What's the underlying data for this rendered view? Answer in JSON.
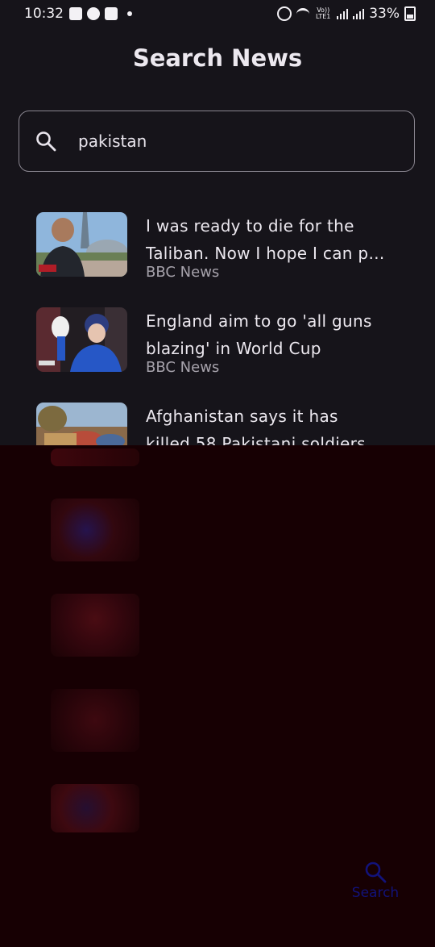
{
  "status_bar": {
    "time": "10:32",
    "network_tag": "Vo)) LTE1",
    "battery": "33%"
  },
  "header": {
    "title": "Search News"
  },
  "search": {
    "value": "pakistan",
    "icon": "search-icon"
  },
  "results": [
    {
      "headline_line1": "I was ready to die for the",
      "headline_line2": "Taliban. Now I hope I can p…",
      "source": "BBC News"
    },
    {
      "headline_line1": "England aim to go 'all guns",
      "headline_line2": "blazing' in World Cup",
      "source": "BBC News"
    },
    {
      "headline_line1": "Afghanistan says it has",
      "headline_line2": "killed 58 Pakistani soldiers…",
      "source": ""
    }
  ],
  "bottom_nav": {
    "search_label": "Search",
    "search_icon": "search-icon"
  },
  "colors": {
    "background": "#16141a",
    "overlay": "#170003",
    "nav_active": "#12127a"
  }
}
